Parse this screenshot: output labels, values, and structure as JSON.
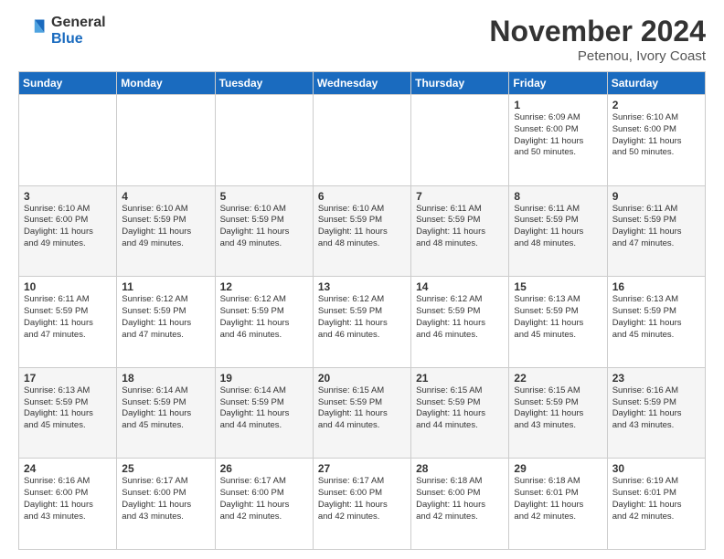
{
  "header": {
    "logo_general": "General",
    "logo_blue": "Blue",
    "title": "November 2024",
    "subtitle": "Petenou, Ivory Coast"
  },
  "days_of_week": [
    "Sunday",
    "Monday",
    "Tuesday",
    "Wednesday",
    "Thursday",
    "Friday",
    "Saturday"
  ],
  "weeks": [
    [
      {
        "day": "",
        "info": ""
      },
      {
        "day": "",
        "info": ""
      },
      {
        "day": "",
        "info": ""
      },
      {
        "day": "",
        "info": ""
      },
      {
        "day": "",
        "info": ""
      },
      {
        "day": "1",
        "info": "Sunrise: 6:09 AM\nSunset: 6:00 PM\nDaylight: 11 hours\nand 50 minutes."
      },
      {
        "day": "2",
        "info": "Sunrise: 6:10 AM\nSunset: 6:00 PM\nDaylight: 11 hours\nand 50 minutes."
      }
    ],
    [
      {
        "day": "3",
        "info": "Sunrise: 6:10 AM\nSunset: 6:00 PM\nDaylight: 11 hours\nand 49 minutes."
      },
      {
        "day": "4",
        "info": "Sunrise: 6:10 AM\nSunset: 5:59 PM\nDaylight: 11 hours\nand 49 minutes."
      },
      {
        "day": "5",
        "info": "Sunrise: 6:10 AM\nSunset: 5:59 PM\nDaylight: 11 hours\nand 49 minutes."
      },
      {
        "day": "6",
        "info": "Sunrise: 6:10 AM\nSunset: 5:59 PM\nDaylight: 11 hours\nand 48 minutes."
      },
      {
        "day": "7",
        "info": "Sunrise: 6:11 AM\nSunset: 5:59 PM\nDaylight: 11 hours\nand 48 minutes."
      },
      {
        "day": "8",
        "info": "Sunrise: 6:11 AM\nSunset: 5:59 PM\nDaylight: 11 hours\nand 48 minutes."
      },
      {
        "day": "9",
        "info": "Sunrise: 6:11 AM\nSunset: 5:59 PM\nDaylight: 11 hours\nand 47 minutes."
      }
    ],
    [
      {
        "day": "10",
        "info": "Sunrise: 6:11 AM\nSunset: 5:59 PM\nDaylight: 11 hours\nand 47 minutes."
      },
      {
        "day": "11",
        "info": "Sunrise: 6:12 AM\nSunset: 5:59 PM\nDaylight: 11 hours\nand 47 minutes."
      },
      {
        "day": "12",
        "info": "Sunrise: 6:12 AM\nSunset: 5:59 PM\nDaylight: 11 hours\nand 46 minutes."
      },
      {
        "day": "13",
        "info": "Sunrise: 6:12 AM\nSunset: 5:59 PM\nDaylight: 11 hours\nand 46 minutes."
      },
      {
        "day": "14",
        "info": "Sunrise: 6:12 AM\nSunset: 5:59 PM\nDaylight: 11 hours\nand 46 minutes."
      },
      {
        "day": "15",
        "info": "Sunrise: 6:13 AM\nSunset: 5:59 PM\nDaylight: 11 hours\nand 45 minutes."
      },
      {
        "day": "16",
        "info": "Sunrise: 6:13 AM\nSunset: 5:59 PM\nDaylight: 11 hours\nand 45 minutes."
      }
    ],
    [
      {
        "day": "17",
        "info": "Sunrise: 6:13 AM\nSunset: 5:59 PM\nDaylight: 11 hours\nand 45 minutes."
      },
      {
        "day": "18",
        "info": "Sunrise: 6:14 AM\nSunset: 5:59 PM\nDaylight: 11 hours\nand 45 minutes."
      },
      {
        "day": "19",
        "info": "Sunrise: 6:14 AM\nSunset: 5:59 PM\nDaylight: 11 hours\nand 44 minutes."
      },
      {
        "day": "20",
        "info": "Sunrise: 6:15 AM\nSunset: 5:59 PM\nDaylight: 11 hours\nand 44 minutes."
      },
      {
        "day": "21",
        "info": "Sunrise: 6:15 AM\nSunset: 5:59 PM\nDaylight: 11 hours\nand 44 minutes."
      },
      {
        "day": "22",
        "info": "Sunrise: 6:15 AM\nSunset: 5:59 PM\nDaylight: 11 hours\nand 43 minutes."
      },
      {
        "day": "23",
        "info": "Sunrise: 6:16 AM\nSunset: 5:59 PM\nDaylight: 11 hours\nand 43 minutes."
      }
    ],
    [
      {
        "day": "24",
        "info": "Sunrise: 6:16 AM\nSunset: 6:00 PM\nDaylight: 11 hours\nand 43 minutes."
      },
      {
        "day": "25",
        "info": "Sunrise: 6:17 AM\nSunset: 6:00 PM\nDaylight: 11 hours\nand 43 minutes."
      },
      {
        "day": "26",
        "info": "Sunrise: 6:17 AM\nSunset: 6:00 PM\nDaylight: 11 hours\nand 42 minutes."
      },
      {
        "day": "27",
        "info": "Sunrise: 6:17 AM\nSunset: 6:00 PM\nDaylight: 11 hours\nand 42 minutes."
      },
      {
        "day": "28",
        "info": "Sunrise: 6:18 AM\nSunset: 6:00 PM\nDaylight: 11 hours\nand 42 minutes."
      },
      {
        "day": "29",
        "info": "Sunrise: 6:18 AM\nSunset: 6:01 PM\nDaylight: 11 hours\nand 42 minutes."
      },
      {
        "day": "30",
        "info": "Sunrise: 6:19 AM\nSunset: 6:01 PM\nDaylight: 11 hours\nand 42 minutes."
      }
    ]
  ]
}
